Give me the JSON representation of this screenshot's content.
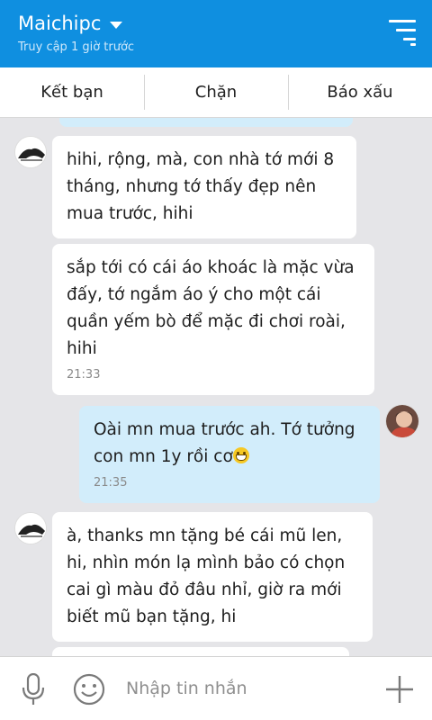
{
  "header": {
    "title": "Maichipc",
    "status": "Truy cập 1 giờ trước"
  },
  "actions": [
    {
      "label": "Kết bạn"
    },
    {
      "label": "Chặn"
    },
    {
      "label": "Báo xấu"
    }
  ],
  "messages": [
    {
      "text": "hihi, rộng, mà, con nhà tớ mới 8 tháng, nhưng tớ thấy đẹp nên mua trước, hihi"
    },
    {
      "text": "sắp tới có cái áo khoác là mặc vừa đấy, tớ ngắm áo ý cho một cái quần yếm bò để mặc đi chơi roài, hihi",
      "time": "21:33"
    },
    {
      "text": "Oài mn mua trước ah. Tớ tưởng con mn 1y rồi cơ",
      "time": "21:35"
    },
    {
      "text": "à, thanks mn tặng bé cái mũ len, hi, nhìn món lạ mình bảo có chọn cai gì màu đỏ đâu nhỉ, giờ ra mới biết mũ bạn tặng, hi"
    }
  ],
  "composer": {
    "placeholder": "Nhập tin nhắn"
  },
  "colors": {
    "header": "#0f8fe0",
    "outgoing_bubble": "#d2edfb",
    "incoming_bubble": "#ffffff",
    "background": "#e5e5e8"
  }
}
